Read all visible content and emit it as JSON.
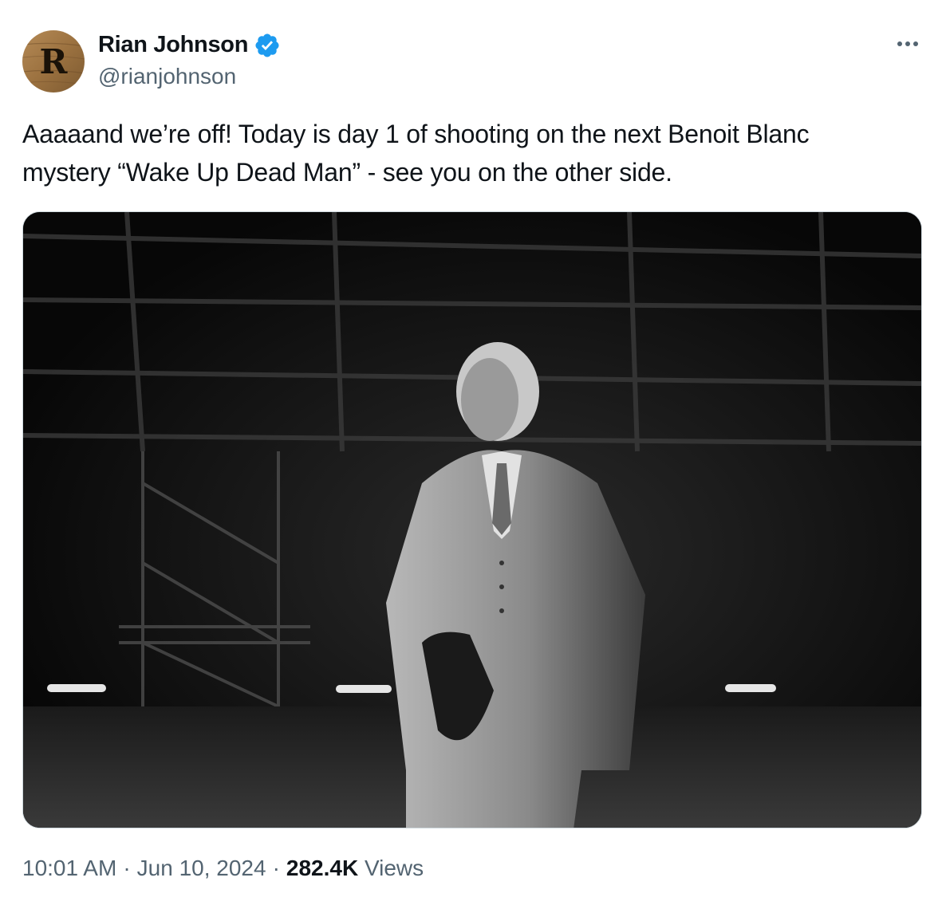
{
  "author": {
    "name": "Rian Johnson",
    "handle": "@rianjohnson",
    "avatar_letter": "R",
    "verified": true,
    "verified_color": "#1d9bf0"
  },
  "tweet": {
    "text_lines": [
      "Aaaaand we’re off! Today is day 1 of shooting on the next Benoit Blanc",
      "mystery “Wake Up Dead Man” - see you on the other side."
    ],
    "media": {
      "kind": "photo",
      "tone": "black-and-white"
    }
  },
  "meta": {
    "time": "10:01 AM",
    "separator": "·",
    "date": "Jun 10, 2024",
    "views_count": "282.4K",
    "views_label": "Views"
  },
  "icons": {
    "more": "more-horizontal-icon",
    "verified": "verified-badge-icon"
  },
  "colors": {
    "text": "#0f1419",
    "secondary_text": "#536471",
    "border": "#cfd9de"
  }
}
